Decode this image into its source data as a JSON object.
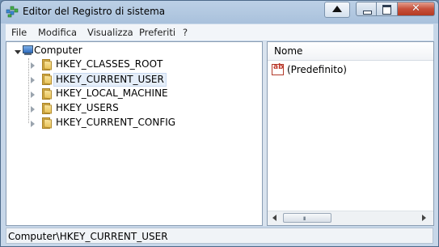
{
  "window": {
    "title": "Editor del Registro di sistema"
  },
  "menu": {
    "items": [
      "File",
      "Modifica",
      "Visualizza",
      "Preferiti",
      "?"
    ]
  },
  "tree": {
    "root": "Computer",
    "hives": [
      {
        "label": "HKEY_CLASSES_ROOT",
        "selected": false
      },
      {
        "label": "HKEY_CURRENT_USER",
        "selected": true
      },
      {
        "label": "HKEY_LOCAL_MACHINE",
        "selected": false
      },
      {
        "label": "HKEY_USERS",
        "selected": false
      },
      {
        "label": "HKEY_CURRENT_CONFIG",
        "selected": false
      }
    ]
  },
  "values": {
    "column_name": "Nome",
    "rows": [
      {
        "name": "(Predefinito)",
        "icon": "string-value-icon"
      }
    ],
    "scroll_grip": "III"
  },
  "status": {
    "path": "Computer\\HKEY_CURRENT_USER"
  }
}
